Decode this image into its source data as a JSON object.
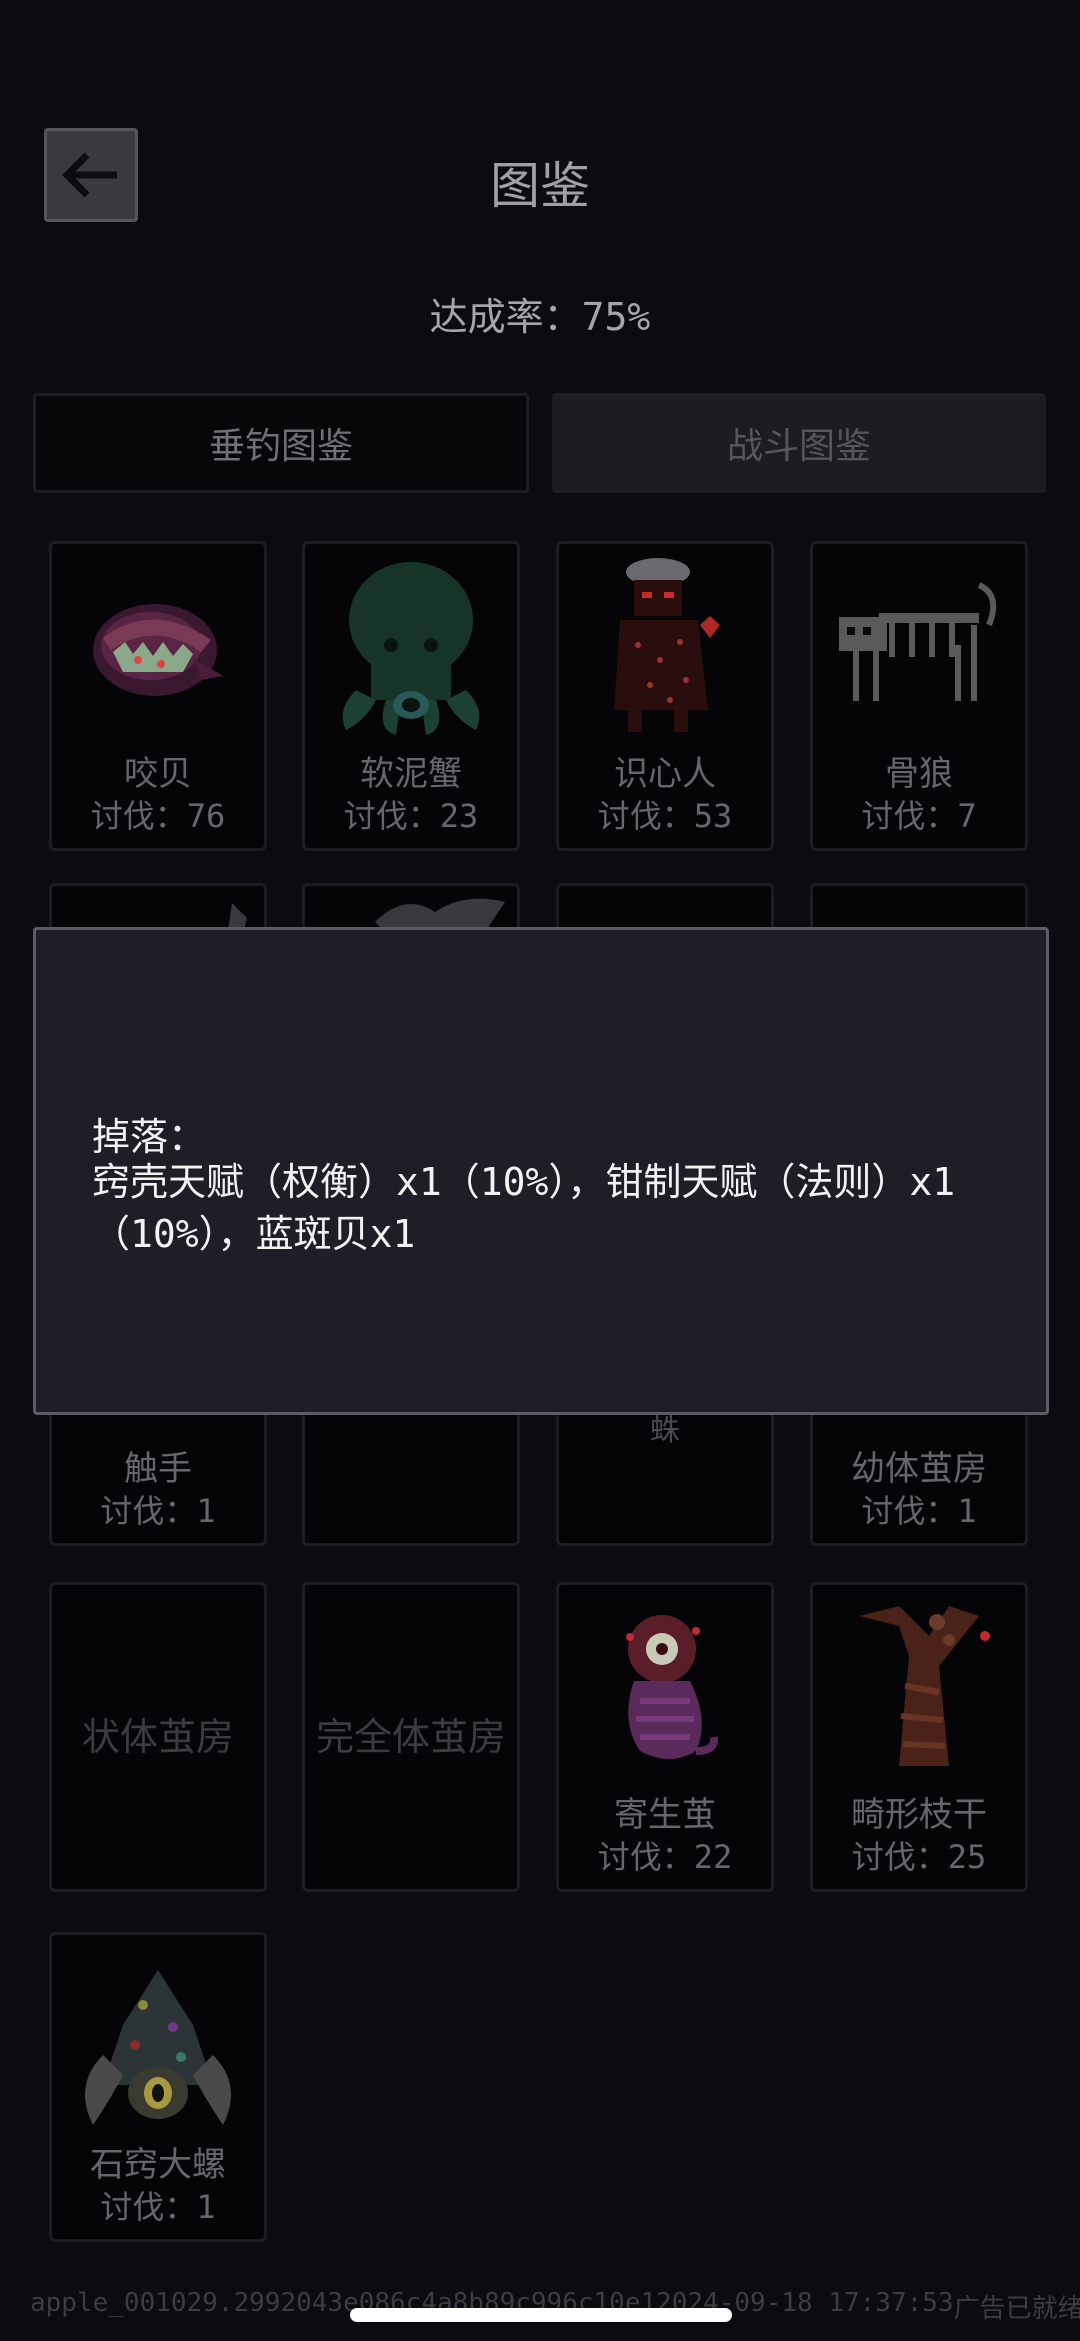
{
  "header": {
    "title": "图鉴",
    "back_icon": "arrow-left-icon"
  },
  "completion": {
    "text": "达成率：75%"
  },
  "tabs": [
    {
      "label": "垂钓图鉴",
      "selected": false
    },
    {
      "label": "战斗图鉴",
      "selected": true
    }
  ],
  "cards": {
    "row1": [
      {
        "name": "咬贝",
        "count": "讨伐：76"
      },
      {
        "name": "软泥蟹",
        "count": "讨伐：23"
      },
      {
        "name": "识心人",
        "count": "讨伐：53"
      },
      {
        "name": "骨狼",
        "count": "讨伐：7"
      }
    ],
    "row3": [
      {
        "name": "触手",
        "count": "讨伐：1"
      },
      {
        "name": "",
        "count": ""
      },
      {
        "name": "蛛",
        "count": ""
      },
      {
        "name": "幼体茧房",
        "count": "讨伐：1"
      }
    ],
    "row4": [
      {
        "name": "状体茧房",
        "count": ""
      },
      {
        "name": "完全体茧房",
        "count": ""
      },
      {
        "name": "寄生茧",
        "count": "讨伐：22"
      },
      {
        "name": "畸形枝干",
        "count": "讨伐：25"
      }
    ],
    "row5": [
      {
        "name": "石窍大螺",
        "count": "讨伐：1"
      }
    ]
  },
  "popup": {
    "label": "掉落：",
    "content": "窍壳天赋（权衡）x1（10%），钳制天赋（法则）x1（10%），蓝斑贝x1"
  },
  "footer": {
    "left": "apple_001029.2992043e086c4a8b89c996c10e1",
    "middle": "2024-09-18 17:37:53",
    "right": "广告已就绪"
  }
}
